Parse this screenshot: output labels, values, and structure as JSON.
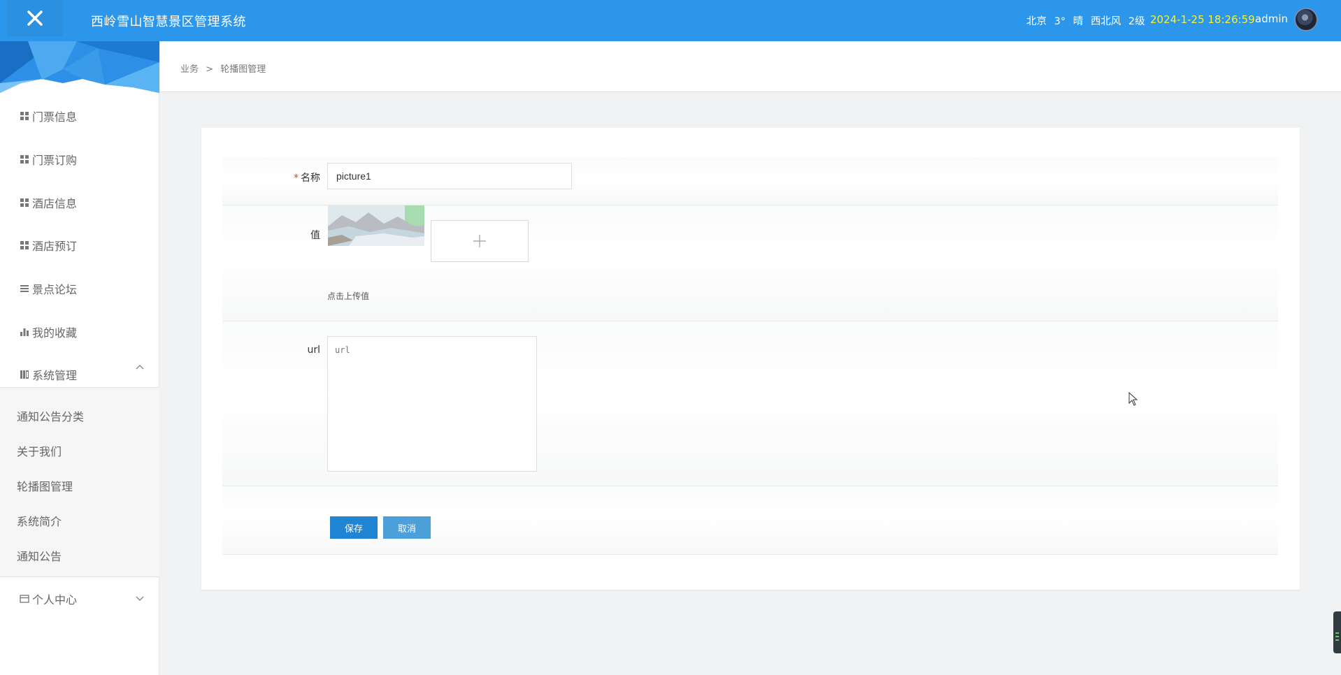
{
  "header": {
    "title": "西岭雪山智慧景区管理系统",
    "weather": {
      "city": "北京",
      "temp": "3°",
      "condition": "晴",
      "wind": "西北风",
      "level": "2级"
    },
    "datetime": "2024-1-25 18:26:59",
    "username": "admin"
  },
  "sidebar": {
    "items": [
      {
        "label": "门票信息",
        "icon": "grid-icon"
      },
      {
        "label": "门票订购",
        "icon": "grid-icon"
      },
      {
        "label": "酒店信息",
        "icon": "grid-icon"
      },
      {
        "label": "酒店预订",
        "icon": "grid-icon"
      },
      {
        "label": "景点论坛",
        "icon": "list-icon"
      },
      {
        "label": "我的收藏",
        "icon": "bar-chart-icon"
      },
      {
        "label": "系统管理",
        "icon": "book-icon",
        "expanded": true
      },
      {
        "label": "个人中心",
        "icon": "card-icon",
        "expanded": false
      }
    ],
    "submenu": [
      "通知公告分类",
      "关于我们",
      "轮播图管理",
      "系统简介",
      "通知公告"
    ]
  },
  "breadcrumb": {
    "root": "业务",
    "sep": ">",
    "current": "轮播图管理"
  },
  "form": {
    "name_label": "名称",
    "name_value": "picture1",
    "value_label": "值",
    "upload_hint": "点击上传值",
    "url_label": "url",
    "url_placeholder": "url",
    "save_label": "保存",
    "cancel_label": "取消"
  },
  "colors": {
    "header_bg": "#2b96ea",
    "clock": "#f7f03a",
    "primary_button": "#1f84d1",
    "secondary_button": "#4ba0d9",
    "required": "#e03a3a"
  }
}
